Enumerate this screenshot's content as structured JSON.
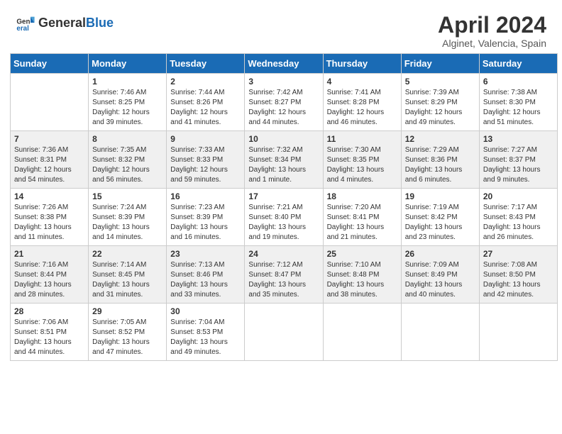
{
  "header": {
    "logo_general": "General",
    "logo_blue": "Blue",
    "month_year": "April 2024",
    "location": "Alginet, Valencia, Spain"
  },
  "days_of_week": [
    "Sunday",
    "Monday",
    "Tuesday",
    "Wednesday",
    "Thursday",
    "Friday",
    "Saturday"
  ],
  "weeks": [
    [
      {
        "day": "",
        "sunrise": "",
        "sunset": "",
        "daylight": ""
      },
      {
        "day": "1",
        "sunrise": "Sunrise: 7:46 AM",
        "sunset": "Sunset: 8:25 PM",
        "daylight": "Daylight: 12 hours and 39 minutes."
      },
      {
        "day": "2",
        "sunrise": "Sunrise: 7:44 AM",
        "sunset": "Sunset: 8:26 PM",
        "daylight": "Daylight: 12 hours and 41 minutes."
      },
      {
        "day": "3",
        "sunrise": "Sunrise: 7:42 AM",
        "sunset": "Sunset: 8:27 PM",
        "daylight": "Daylight: 12 hours and 44 minutes."
      },
      {
        "day": "4",
        "sunrise": "Sunrise: 7:41 AM",
        "sunset": "Sunset: 8:28 PM",
        "daylight": "Daylight: 12 hours and 46 minutes."
      },
      {
        "day": "5",
        "sunrise": "Sunrise: 7:39 AM",
        "sunset": "Sunset: 8:29 PM",
        "daylight": "Daylight: 12 hours and 49 minutes."
      },
      {
        "day": "6",
        "sunrise": "Sunrise: 7:38 AM",
        "sunset": "Sunset: 8:30 PM",
        "daylight": "Daylight: 12 hours and 51 minutes."
      }
    ],
    [
      {
        "day": "7",
        "sunrise": "Sunrise: 7:36 AM",
        "sunset": "Sunset: 8:31 PM",
        "daylight": "Daylight: 12 hours and 54 minutes."
      },
      {
        "day": "8",
        "sunrise": "Sunrise: 7:35 AM",
        "sunset": "Sunset: 8:32 PM",
        "daylight": "Daylight: 12 hours and 56 minutes."
      },
      {
        "day": "9",
        "sunrise": "Sunrise: 7:33 AM",
        "sunset": "Sunset: 8:33 PM",
        "daylight": "Daylight: 12 hours and 59 minutes."
      },
      {
        "day": "10",
        "sunrise": "Sunrise: 7:32 AM",
        "sunset": "Sunset: 8:34 PM",
        "daylight": "Daylight: 13 hours and 1 minute."
      },
      {
        "day": "11",
        "sunrise": "Sunrise: 7:30 AM",
        "sunset": "Sunset: 8:35 PM",
        "daylight": "Daylight: 13 hours and 4 minutes."
      },
      {
        "day": "12",
        "sunrise": "Sunrise: 7:29 AM",
        "sunset": "Sunset: 8:36 PM",
        "daylight": "Daylight: 13 hours and 6 minutes."
      },
      {
        "day": "13",
        "sunrise": "Sunrise: 7:27 AM",
        "sunset": "Sunset: 8:37 PM",
        "daylight": "Daylight: 13 hours and 9 minutes."
      }
    ],
    [
      {
        "day": "14",
        "sunrise": "Sunrise: 7:26 AM",
        "sunset": "Sunset: 8:38 PM",
        "daylight": "Daylight: 13 hours and 11 minutes."
      },
      {
        "day": "15",
        "sunrise": "Sunrise: 7:24 AM",
        "sunset": "Sunset: 8:39 PM",
        "daylight": "Daylight: 13 hours and 14 minutes."
      },
      {
        "day": "16",
        "sunrise": "Sunrise: 7:23 AM",
        "sunset": "Sunset: 8:39 PM",
        "daylight": "Daylight: 13 hours and 16 minutes."
      },
      {
        "day": "17",
        "sunrise": "Sunrise: 7:21 AM",
        "sunset": "Sunset: 8:40 PM",
        "daylight": "Daylight: 13 hours and 19 minutes."
      },
      {
        "day": "18",
        "sunrise": "Sunrise: 7:20 AM",
        "sunset": "Sunset: 8:41 PM",
        "daylight": "Daylight: 13 hours and 21 minutes."
      },
      {
        "day": "19",
        "sunrise": "Sunrise: 7:19 AM",
        "sunset": "Sunset: 8:42 PM",
        "daylight": "Daylight: 13 hours and 23 minutes."
      },
      {
        "day": "20",
        "sunrise": "Sunrise: 7:17 AM",
        "sunset": "Sunset: 8:43 PM",
        "daylight": "Daylight: 13 hours and 26 minutes."
      }
    ],
    [
      {
        "day": "21",
        "sunrise": "Sunrise: 7:16 AM",
        "sunset": "Sunset: 8:44 PM",
        "daylight": "Daylight: 13 hours and 28 minutes."
      },
      {
        "day": "22",
        "sunrise": "Sunrise: 7:14 AM",
        "sunset": "Sunset: 8:45 PM",
        "daylight": "Daylight: 13 hours and 31 minutes."
      },
      {
        "day": "23",
        "sunrise": "Sunrise: 7:13 AM",
        "sunset": "Sunset: 8:46 PM",
        "daylight": "Daylight: 13 hours and 33 minutes."
      },
      {
        "day": "24",
        "sunrise": "Sunrise: 7:12 AM",
        "sunset": "Sunset: 8:47 PM",
        "daylight": "Daylight: 13 hours and 35 minutes."
      },
      {
        "day": "25",
        "sunrise": "Sunrise: 7:10 AM",
        "sunset": "Sunset: 8:48 PM",
        "daylight": "Daylight: 13 hours and 38 minutes."
      },
      {
        "day": "26",
        "sunrise": "Sunrise: 7:09 AM",
        "sunset": "Sunset: 8:49 PM",
        "daylight": "Daylight: 13 hours and 40 minutes."
      },
      {
        "day": "27",
        "sunrise": "Sunrise: 7:08 AM",
        "sunset": "Sunset: 8:50 PM",
        "daylight": "Daylight: 13 hours and 42 minutes."
      }
    ],
    [
      {
        "day": "28",
        "sunrise": "Sunrise: 7:06 AM",
        "sunset": "Sunset: 8:51 PM",
        "daylight": "Daylight: 13 hours and 44 minutes."
      },
      {
        "day": "29",
        "sunrise": "Sunrise: 7:05 AM",
        "sunset": "Sunset: 8:52 PM",
        "daylight": "Daylight: 13 hours and 47 minutes."
      },
      {
        "day": "30",
        "sunrise": "Sunrise: 7:04 AM",
        "sunset": "Sunset: 8:53 PM",
        "daylight": "Daylight: 13 hours and 49 minutes."
      },
      {
        "day": "",
        "sunrise": "",
        "sunset": "",
        "daylight": ""
      },
      {
        "day": "",
        "sunrise": "",
        "sunset": "",
        "daylight": ""
      },
      {
        "day": "",
        "sunrise": "",
        "sunset": "",
        "daylight": ""
      },
      {
        "day": "",
        "sunrise": "",
        "sunset": "",
        "daylight": ""
      }
    ]
  ],
  "row_styles": [
    "row-white",
    "row-shaded",
    "row-white",
    "row-shaded",
    "row-white"
  ]
}
